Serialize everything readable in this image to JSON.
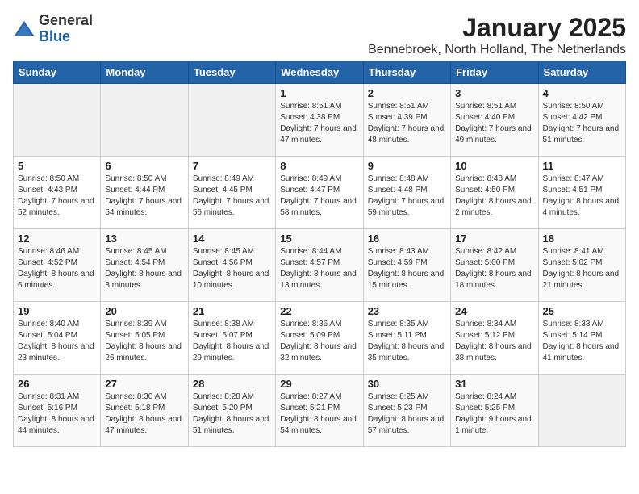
{
  "logo": {
    "general": "General",
    "blue": "Blue"
  },
  "header": {
    "month_title": "January 2025",
    "subtitle": "Bennebroek, North Holland, The Netherlands"
  },
  "weekdays": [
    "Sunday",
    "Monday",
    "Tuesday",
    "Wednesday",
    "Thursday",
    "Friday",
    "Saturday"
  ],
  "weeks": [
    [
      {
        "day": "",
        "info": ""
      },
      {
        "day": "",
        "info": ""
      },
      {
        "day": "",
        "info": ""
      },
      {
        "day": "1",
        "info": "Sunrise: 8:51 AM\nSunset: 4:38 PM\nDaylight: 7 hours and 47 minutes."
      },
      {
        "day": "2",
        "info": "Sunrise: 8:51 AM\nSunset: 4:39 PM\nDaylight: 7 hours and 48 minutes."
      },
      {
        "day": "3",
        "info": "Sunrise: 8:51 AM\nSunset: 4:40 PM\nDaylight: 7 hours and 49 minutes."
      },
      {
        "day": "4",
        "info": "Sunrise: 8:50 AM\nSunset: 4:42 PM\nDaylight: 7 hours and 51 minutes."
      }
    ],
    [
      {
        "day": "5",
        "info": "Sunrise: 8:50 AM\nSunset: 4:43 PM\nDaylight: 7 hours and 52 minutes."
      },
      {
        "day": "6",
        "info": "Sunrise: 8:50 AM\nSunset: 4:44 PM\nDaylight: 7 hours and 54 minutes."
      },
      {
        "day": "7",
        "info": "Sunrise: 8:49 AM\nSunset: 4:45 PM\nDaylight: 7 hours and 56 minutes."
      },
      {
        "day": "8",
        "info": "Sunrise: 8:49 AM\nSunset: 4:47 PM\nDaylight: 7 hours and 58 minutes."
      },
      {
        "day": "9",
        "info": "Sunrise: 8:48 AM\nSunset: 4:48 PM\nDaylight: 7 hours and 59 minutes."
      },
      {
        "day": "10",
        "info": "Sunrise: 8:48 AM\nSunset: 4:50 PM\nDaylight: 8 hours and 2 minutes."
      },
      {
        "day": "11",
        "info": "Sunrise: 8:47 AM\nSunset: 4:51 PM\nDaylight: 8 hours and 4 minutes."
      }
    ],
    [
      {
        "day": "12",
        "info": "Sunrise: 8:46 AM\nSunset: 4:52 PM\nDaylight: 8 hours and 6 minutes."
      },
      {
        "day": "13",
        "info": "Sunrise: 8:45 AM\nSunset: 4:54 PM\nDaylight: 8 hours and 8 minutes."
      },
      {
        "day": "14",
        "info": "Sunrise: 8:45 AM\nSunset: 4:56 PM\nDaylight: 8 hours and 10 minutes."
      },
      {
        "day": "15",
        "info": "Sunrise: 8:44 AM\nSunset: 4:57 PM\nDaylight: 8 hours and 13 minutes."
      },
      {
        "day": "16",
        "info": "Sunrise: 8:43 AM\nSunset: 4:59 PM\nDaylight: 8 hours and 15 minutes."
      },
      {
        "day": "17",
        "info": "Sunrise: 8:42 AM\nSunset: 5:00 PM\nDaylight: 8 hours and 18 minutes."
      },
      {
        "day": "18",
        "info": "Sunrise: 8:41 AM\nSunset: 5:02 PM\nDaylight: 8 hours and 21 minutes."
      }
    ],
    [
      {
        "day": "19",
        "info": "Sunrise: 8:40 AM\nSunset: 5:04 PM\nDaylight: 8 hours and 23 minutes."
      },
      {
        "day": "20",
        "info": "Sunrise: 8:39 AM\nSunset: 5:05 PM\nDaylight: 8 hours and 26 minutes."
      },
      {
        "day": "21",
        "info": "Sunrise: 8:38 AM\nSunset: 5:07 PM\nDaylight: 8 hours and 29 minutes."
      },
      {
        "day": "22",
        "info": "Sunrise: 8:36 AM\nSunset: 5:09 PM\nDaylight: 8 hours and 32 minutes."
      },
      {
        "day": "23",
        "info": "Sunrise: 8:35 AM\nSunset: 5:11 PM\nDaylight: 8 hours and 35 minutes."
      },
      {
        "day": "24",
        "info": "Sunrise: 8:34 AM\nSunset: 5:12 PM\nDaylight: 8 hours and 38 minutes."
      },
      {
        "day": "25",
        "info": "Sunrise: 8:33 AM\nSunset: 5:14 PM\nDaylight: 8 hours and 41 minutes."
      }
    ],
    [
      {
        "day": "26",
        "info": "Sunrise: 8:31 AM\nSunset: 5:16 PM\nDaylight: 8 hours and 44 minutes."
      },
      {
        "day": "27",
        "info": "Sunrise: 8:30 AM\nSunset: 5:18 PM\nDaylight: 8 hours and 47 minutes."
      },
      {
        "day": "28",
        "info": "Sunrise: 8:28 AM\nSunset: 5:20 PM\nDaylight: 8 hours and 51 minutes."
      },
      {
        "day": "29",
        "info": "Sunrise: 8:27 AM\nSunset: 5:21 PM\nDaylight: 8 hours and 54 minutes."
      },
      {
        "day": "30",
        "info": "Sunrise: 8:25 AM\nSunset: 5:23 PM\nDaylight: 8 hours and 57 minutes."
      },
      {
        "day": "31",
        "info": "Sunrise: 8:24 AM\nSunset: 5:25 PM\nDaylight: 9 hours and 1 minute."
      },
      {
        "day": "",
        "info": ""
      }
    ]
  ]
}
